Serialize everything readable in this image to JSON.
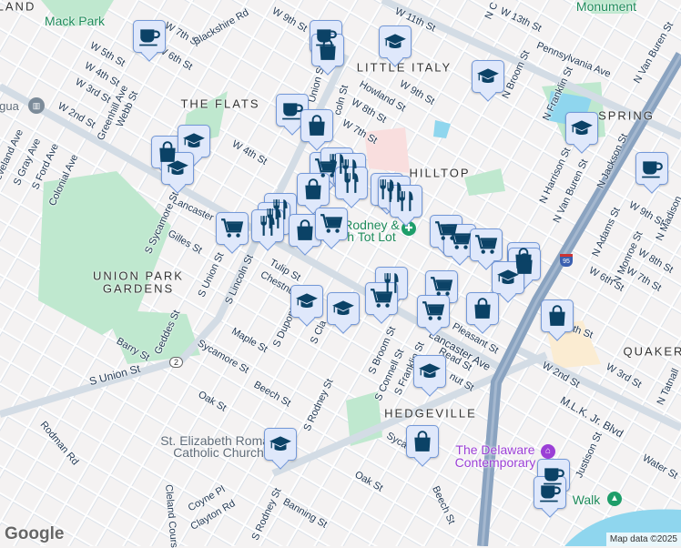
{
  "map": {
    "attribution": "Map data ©2025",
    "logo": "Google",
    "route_badge": "2",
    "interstate_badge": "95",
    "colors": {
      "marker_fill": "#dfe8fb",
      "marker_border": "#7398d8",
      "icon": "#0b4266",
      "park": "#bfe8cf",
      "water": "#8fd6ee",
      "highway": "#8aa3c0"
    }
  },
  "areas": [
    "LAND",
    "THE FLATS",
    "LITTLE ITALY",
    "HILLTOP",
    "SPRING",
    "UNION PARK",
    "GARDENS",
    "QUAKER",
    "HEDGEVILLE"
  ],
  "pois": {
    "mack_park": "Mack Park",
    "monument": "Monument",
    "tot_lot_1": "Rodney &",
    "tot_lot_2": "h Tot Lot",
    "church_1": "St. Elizabeth Roman",
    "church_2": "Catholic Church",
    "museum_1": "The Delaware",
    "museum_2": "Contemporary",
    "walk": "Walk",
    "gua": "gua"
  },
  "streets": [
    "W 9th St",
    "W 7th St",
    "Blackshire Rd",
    "W 6th St",
    "W 5th St",
    "W 4th St",
    "W 3rd St",
    "W 2nd St",
    "Greenhill Ave",
    "Webb St",
    "S Gray Ave",
    "S Ford Ave",
    "Colonial Ave",
    "eveland Ave",
    "W 4th St",
    "Lancaster",
    "S Sycamore St",
    "Gilles St",
    "W 11th St",
    "W 13th St",
    "Pennsylvania Ave",
    "N Van Buren St",
    "W 9th St",
    "Howland St",
    "W 8th St",
    "W 7th St",
    "N Broom St",
    "N Franklin St",
    "N Harrison St",
    "N Van Buren St",
    "N Jackson St",
    "N Adams St",
    "W 9th St",
    "N Madison",
    "N Monroe St",
    "W 8th St",
    "W 6th St",
    "W 7th St",
    "Union St",
    "coln St",
    "S Union St",
    "S Lincoln St",
    "Tulip St",
    "Chestnut",
    "Maple St",
    "Sycamore St",
    "S Dupont",
    "S Cla",
    "Barry St",
    "Geddes St",
    "S Union St",
    "Beech St",
    "Oak St",
    "S Rodney St",
    "Rodman Rd",
    "Cleland Cours",
    "Coyne Pl",
    "Clayton Rd",
    "S Rodney St",
    "Banning St",
    "Oak St",
    "Beech St",
    "Syca",
    "S Broom St",
    "S Connell St",
    "S Franklin St",
    "Pleasant St",
    "Lancaster Ave",
    "Read St",
    "nut St",
    "W 2nd St",
    "W 3rd St",
    "M.L.K. Jr. Blvd",
    "Justison St",
    "Water St",
    "N Tatnall",
    "th St",
    "N C"
  ]
}
